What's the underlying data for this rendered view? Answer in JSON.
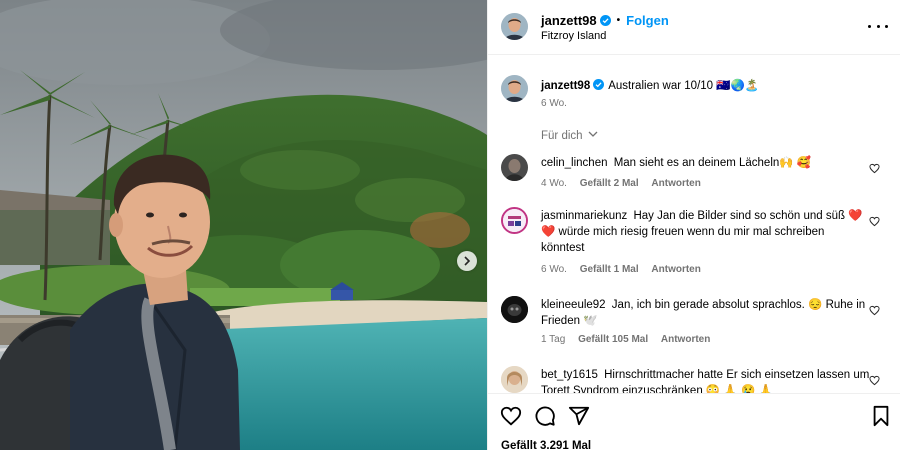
{
  "post": {
    "username": "janzett98",
    "follow_label": "Folgen",
    "location": "Fitzroy Island",
    "caption": "Australien war 10/10 🇦🇺🌏🏝️",
    "caption_time": "6 Wo.",
    "sort_label": "Für dich",
    "likes_summary": "Gefällt 3.291 Mal"
  },
  "comments": [
    {
      "user": "celin_linchen",
      "text": "Man sieht es an deinem Lächeln🙌 🥰",
      "time": "4 Wo.",
      "likes": "Gefällt 2 Mal",
      "reply": "Antworten"
    },
    {
      "user": "jasminmariekunz",
      "text": "Hay Jan die Bilder sind so schön und süß ❤️ ❤️ würde mich riesig freuen wenn du mir mal schreiben könntest",
      "time": "6 Wo.",
      "likes": "Gefällt 1 Mal",
      "reply": "Antworten"
    },
    {
      "user": "kleineeule92",
      "text": "Jan, ich bin gerade absolut sprachlos. 😔 Ruhe in Frieden 🕊️",
      "time": "1 Tag",
      "likes": "Gefällt 105 Mal",
      "reply": "Antworten"
    },
    {
      "user": "bet_ty1615",
      "text": "Hirnschrittmacher hatte Er sich einsetzen lassen um Torett Syndrom einzuschränken 😳 🙏 😢 🙏",
      "time": "",
      "likes": "",
      "reply": ""
    }
  ],
  "colors": {
    "accent": "#0095f6",
    "verified": "#0095f6",
    "muted": "#737373"
  },
  "icons": [
    "verified-badge-icon",
    "more-options-icon",
    "chevron-down-icon",
    "heart-icon",
    "comment-icon",
    "share-icon",
    "bookmark-icon",
    "chevron-right-icon"
  ]
}
